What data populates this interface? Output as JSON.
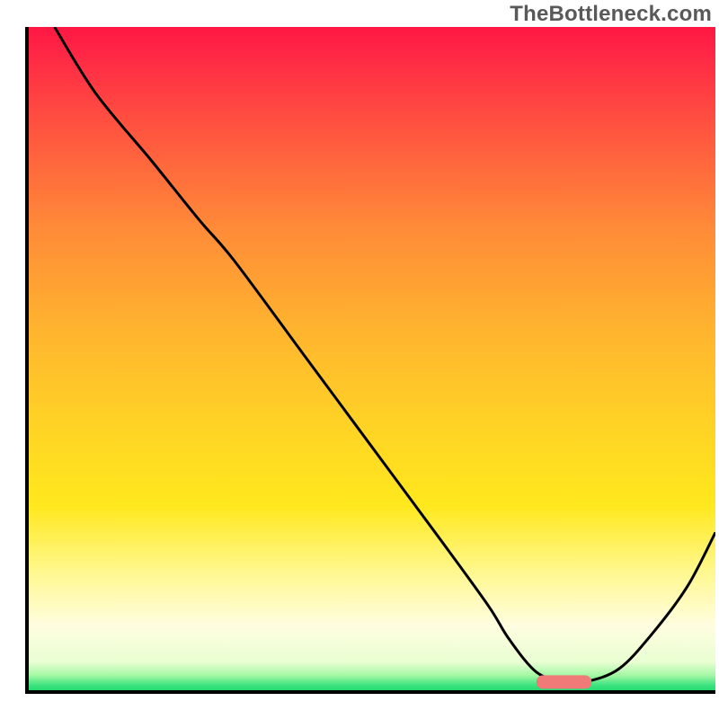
{
  "watermark": "TheBottleneck.com",
  "chart_data": {
    "type": "line",
    "title": "",
    "xlabel": "",
    "ylabel": "",
    "xlim": [
      0,
      100
    ],
    "ylim": [
      0,
      100
    ],
    "background_gradient": {
      "stops": [
        {
          "offset": 0.0,
          "color": "#ff1744"
        },
        {
          "offset": 0.05,
          "color": "#ff2b45"
        },
        {
          "offset": 0.15,
          "color": "#ff5340"
        },
        {
          "offset": 0.3,
          "color": "#ff8a38"
        },
        {
          "offset": 0.45,
          "color": "#ffb32f"
        },
        {
          "offset": 0.6,
          "color": "#ffd325"
        },
        {
          "offset": 0.72,
          "color": "#ffe81d"
        },
        {
          "offset": 0.82,
          "color": "#fff88f"
        },
        {
          "offset": 0.9,
          "color": "#fffde0"
        },
        {
          "offset": 0.955,
          "color": "#e9ffd2"
        },
        {
          "offset": 0.975,
          "color": "#a4f7a4"
        },
        {
          "offset": 0.99,
          "color": "#3be37e"
        },
        {
          "offset": 1.0,
          "color": "#1fd56c"
        }
      ]
    },
    "series": [
      {
        "name": "bottleneck-curve",
        "x": [
          4,
          10,
          18,
          25,
          30,
          40,
          50,
          60,
          67,
          70,
          74,
          78,
          81,
          86,
          91,
          96,
          100
        ],
        "y": [
          100,
          90,
          80,
          71,
          65,
          51,
          37,
          23,
          13,
          8,
          3,
          1.5,
          1.5,
          3.5,
          9,
          16,
          24
        ]
      }
    ],
    "marker": {
      "name": "optimal-zone",
      "x_center": 78,
      "x_width": 8,
      "y": 1.5,
      "color": "#ef7a78"
    },
    "axis_color": "#000000",
    "curve_color": "#000000"
  }
}
